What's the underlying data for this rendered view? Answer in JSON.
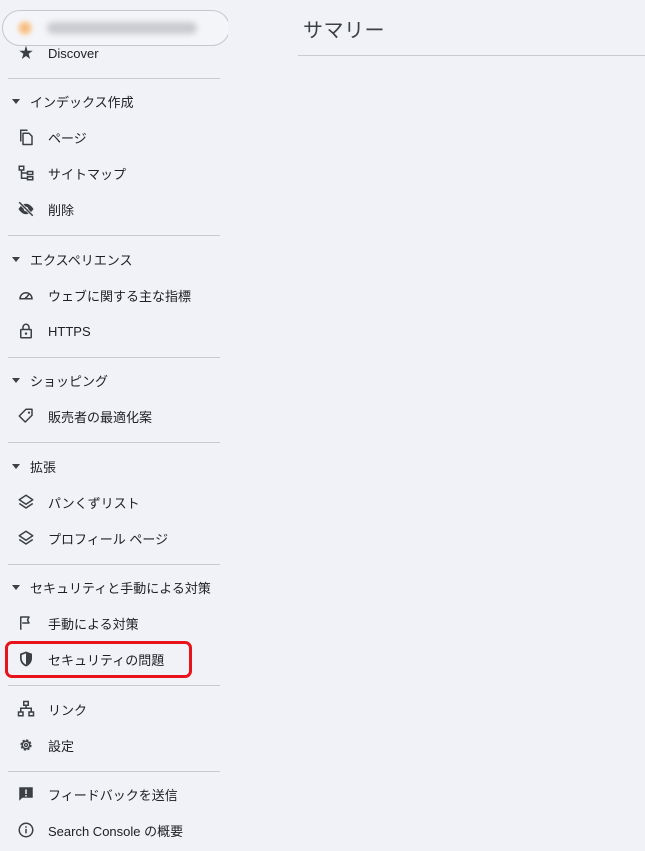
{
  "property_selector": {
    "name": "https://example.com/",
    "favicon": "site-favicon"
  },
  "sidebar": {
    "discover_label": "Discover",
    "sections": [
      {
        "title": "インデックス作成",
        "items": [
          {
            "label": "ページ",
            "icon": "pages-icon"
          },
          {
            "label": "サイトマップ",
            "icon": "sitemap-icon"
          },
          {
            "label": "削除",
            "icon": "removals-icon"
          }
        ]
      },
      {
        "title": "エクスペリエンス",
        "items": [
          {
            "label": "ウェブに関する主な指標",
            "icon": "speedometer-icon"
          },
          {
            "label": "HTTPS",
            "icon": "lock-icon"
          }
        ]
      },
      {
        "title": "ショッピング",
        "items": [
          {
            "label": "販売者の最適化案",
            "icon": "tag-icon"
          }
        ]
      },
      {
        "title": "拡張",
        "items": [
          {
            "label": "パンくずリスト",
            "icon": "layers-icon"
          },
          {
            "label": "プロフィール ページ",
            "icon": "layers-icon"
          }
        ]
      },
      {
        "title": "セキュリティと手動による対策",
        "items": [
          {
            "label": "手動による対策",
            "icon": "flag-icon"
          },
          {
            "label": "セキュリティの問題",
            "icon": "shield-icon",
            "highlighted": true
          }
        ]
      }
    ],
    "links_label": "リンク",
    "settings_label": "設定",
    "feedback_label": "フィードバックを送信",
    "about_label": "Search Console の概要"
  },
  "main": {
    "title": "サマリー"
  },
  "colors": {
    "background": "#f0f2f7",
    "highlight": "#e8121b",
    "divider": "#c8cbd0"
  }
}
